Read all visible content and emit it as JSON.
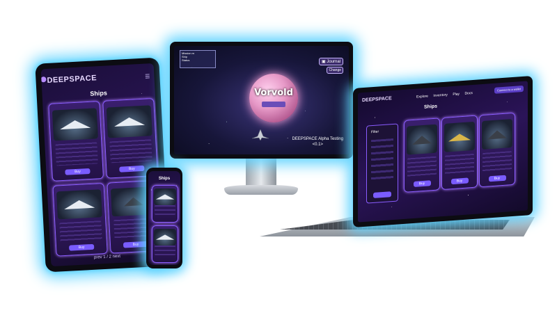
{
  "brand": {
    "name": "DEEPSPACE",
    "accent": "#7a5cff",
    "glow": "#5fd3ff"
  },
  "tablet": {
    "title": "Ships",
    "menu_icon": "hamburger-icon",
    "pager": "prev  1 / 2  next",
    "cards": [
      {
        "ship": "white",
        "button": "Buy"
      },
      {
        "ship": "white",
        "button": "Buy"
      },
      {
        "ship": "white",
        "button": "Buy"
      },
      {
        "ship": "dark",
        "button": "Buy"
      }
    ]
  },
  "monitor": {
    "planet_name": "Vorvold",
    "journal": "Journal",
    "change_label": "Change",
    "alpha_line1": "DEEPSPACE Alpha Testing",
    "alpha_line2": "<0.1>",
    "hud_lines": [
      "Mission m",
      "Ship",
      "Status"
    ]
  },
  "laptop": {
    "nav": [
      "Explore",
      "Inventory",
      "Play",
      "Docs"
    ],
    "connect": "Connect to a wallet",
    "title": "Ships",
    "filter": "Filter",
    "cards": [
      {
        "ship": "dark",
        "button": "Buy"
      },
      {
        "ship": "gold",
        "button": "Buy"
      },
      {
        "ship": "dark",
        "button": "Buy"
      }
    ]
  },
  "phone": {
    "title": "Ships",
    "cards": [
      {
        "ship": "white"
      },
      {
        "ship": "white"
      }
    ]
  }
}
